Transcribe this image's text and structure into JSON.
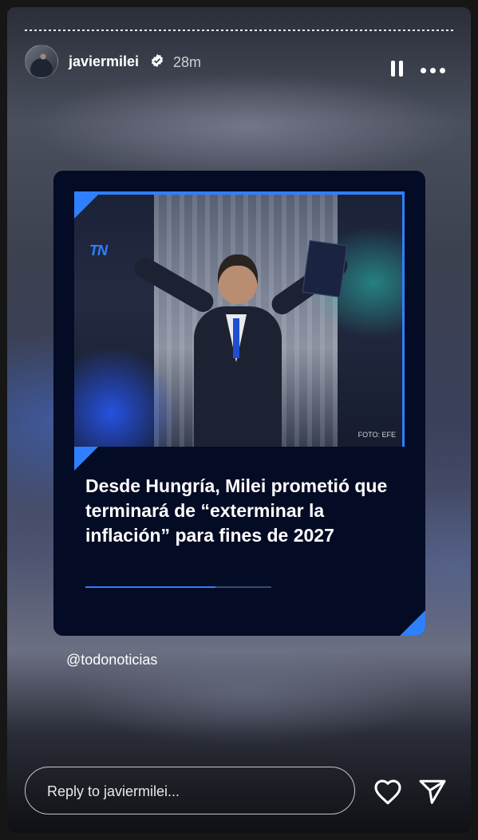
{
  "header": {
    "username": "javiermilei",
    "time_ago": "28m",
    "verified_icon": "verified-badge-icon",
    "pause_icon": "pause-icon",
    "more_icon": "more-options-icon"
  },
  "post": {
    "logo_text": "TN",
    "photo_credit": "FOTO: EFE",
    "headline": "Desde Hungría, Milei prometió que terminará de “exterminar la inflación” para fines de 2027",
    "accent_color": "#2f80ff"
  },
  "mention": "@todonoticias",
  "footer": {
    "reply_placeholder": "Reply to javiermilei...",
    "like_icon": "heart-icon",
    "share_icon": "send-icon"
  }
}
